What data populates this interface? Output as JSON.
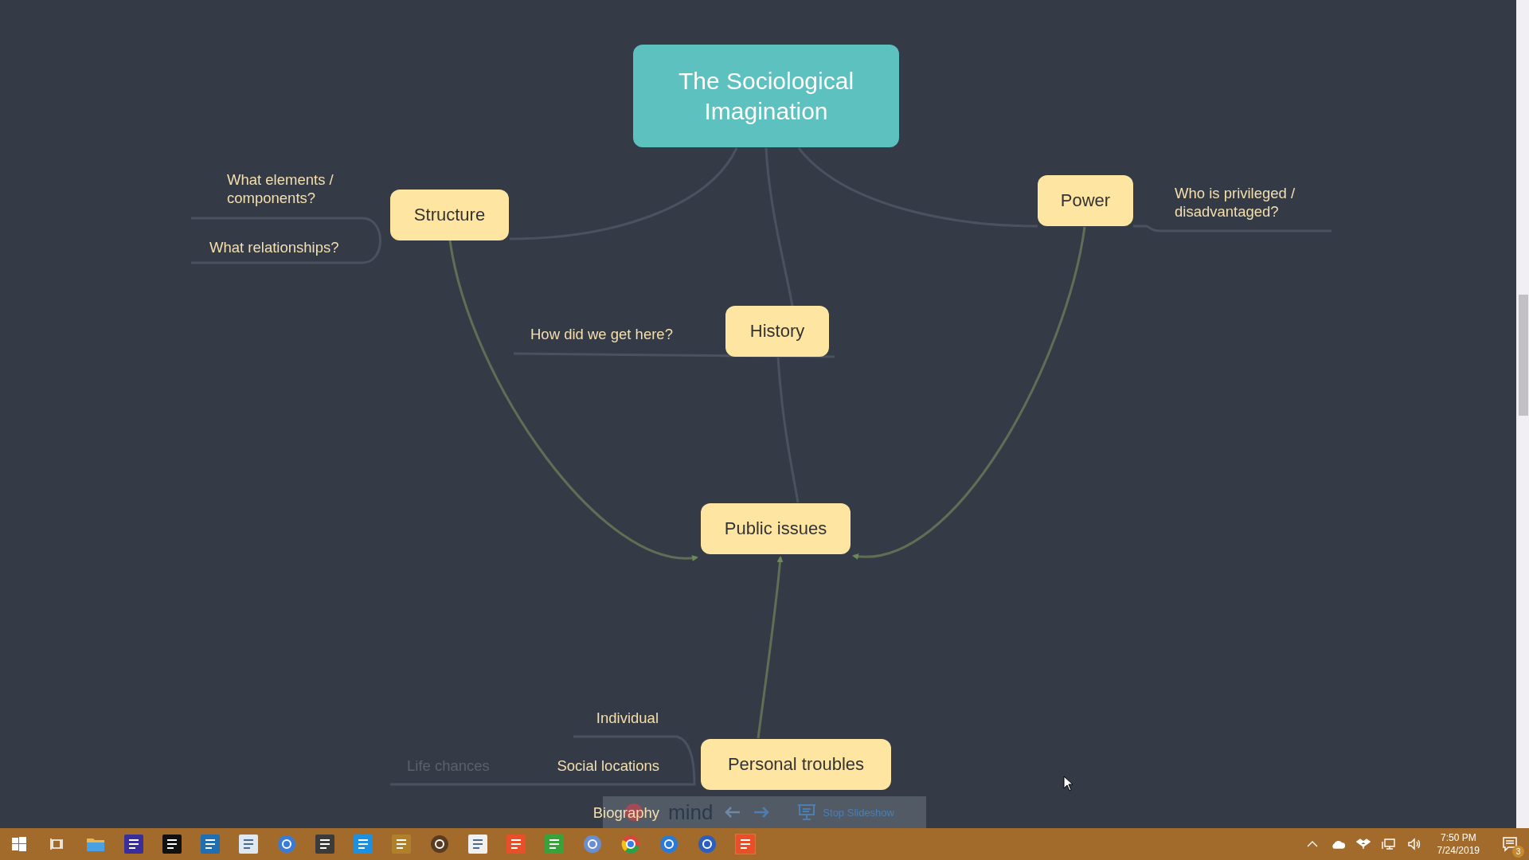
{
  "central_topic": {
    "label": "The Sociological Imagination"
  },
  "topics": [
    {
      "label": "Structure",
      "subtopics": [
        {
          "label": "What elements / components?",
          "dimmed": false
        },
        {
          "label": "What relationships?",
          "dimmed": false
        }
      ]
    },
    {
      "label": "Power",
      "subtopics": [
        {
          "label": "Who is privileged / disadvantaged?",
          "dimmed": false
        }
      ]
    },
    {
      "label": "History",
      "subtopics": [
        {
          "label": "How did we get here?",
          "dimmed": false
        }
      ]
    },
    {
      "label": "Public issues"
    },
    {
      "label": "Personal troubles",
      "subtopics": [
        {
          "label": "Individual",
          "dimmed": false
        },
        {
          "label": "Social locations",
          "dimmed": false,
          "children": [
            {
              "label": "Life chances",
              "dimmed": true
            }
          ]
        },
        {
          "label": "Biography",
          "dimmed": false
        }
      ]
    }
  ],
  "slideshow_bar": {
    "logo": "mind",
    "stop_label": "Stop Slideshow"
  },
  "taskbar": {
    "time": "7:50 PM",
    "date": "7/24/2019",
    "notifications": "3"
  }
}
